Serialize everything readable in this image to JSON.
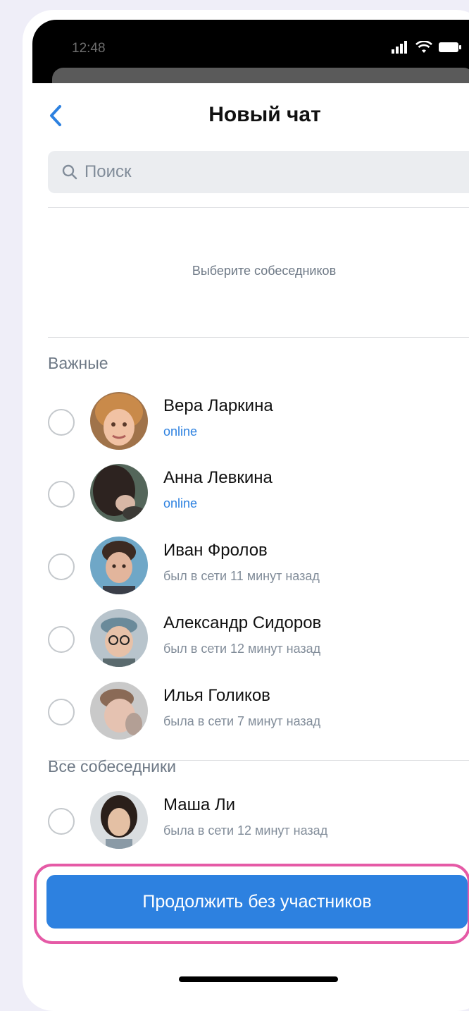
{
  "status_bar": {
    "time": "12:48"
  },
  "header": {
    "title": "Новый чат"
  },
  "search": {
    "placeholder": "Поиск"
  },
  "hint": "Выберите собеседников",
  "sections": {
    "important": {
      "title": "Важные",
      "contacts": [
        {
          "name": "Вера Ларкина",
          "status": "online",
          "online": true
        },
        {
          "name": "Анна Левкина",
          "status": "online",
          "online": true
        },
        {
          "name": "Иван Фролов",
          "status": "был в сети 11 минут назад",
          "online": false
        },
        {
          "name": "Александр Сидоров",
          "status": "был в сети 12 минут назад",
          "online": false
        },
        {
          "name": "Илья Голиков",
          "status": "была в сети 7 минут назад",
          "online": false
        }
      ]
    },
    "all": {
      "title": "Все собеседники",
      "contacts": [
        {
          "name": "Маша Ли",
          "status": "была в сети 12 минут назад",
          "online": false
        }
      ]
    }
  },
  "cta": {
    "label": "Продолжить без участников"
  },
  "colors": {
    "accent": "#2d81e0",
    "highlight": "#e55aa6",
    "secondary_text": "#818c99"
  }
}
